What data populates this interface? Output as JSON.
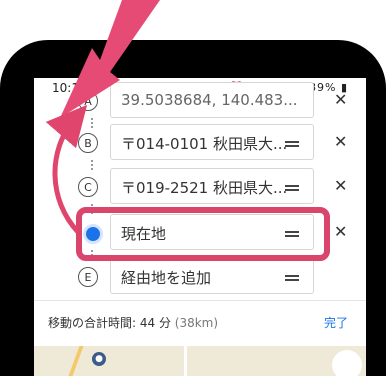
{
  "status_bar": {
    "time": "10:12",
    "icons": "⏰ ✕ ⚲ ≋ .ıl 89% ▮"
  },
  "route": {
    "stops": [
      {
        "marker": "A",
        "text": "39.5038684, 140.483..."
      },
      {
        "marker": "B",
        "text": "〒014-0101 秋田県大..."
      },
      {
        "marker": "C",
        "text": "〒019-2521 秋田県大..."
      },
      {
        "marker": "current",
        "text": "現在地"
      },
      {
        "marker": "E",
        "text": "経由地を追加"
      }
    ]
  },
  "summary": {
    "total_time_label": "移動の合計時間: 44 分",
    "distance": "(38km)",
    "done_label": "完了"
  },
  "colors": {
    "highlight": "#d9456b",
    "accent": "#1a73e8"
  }
}
